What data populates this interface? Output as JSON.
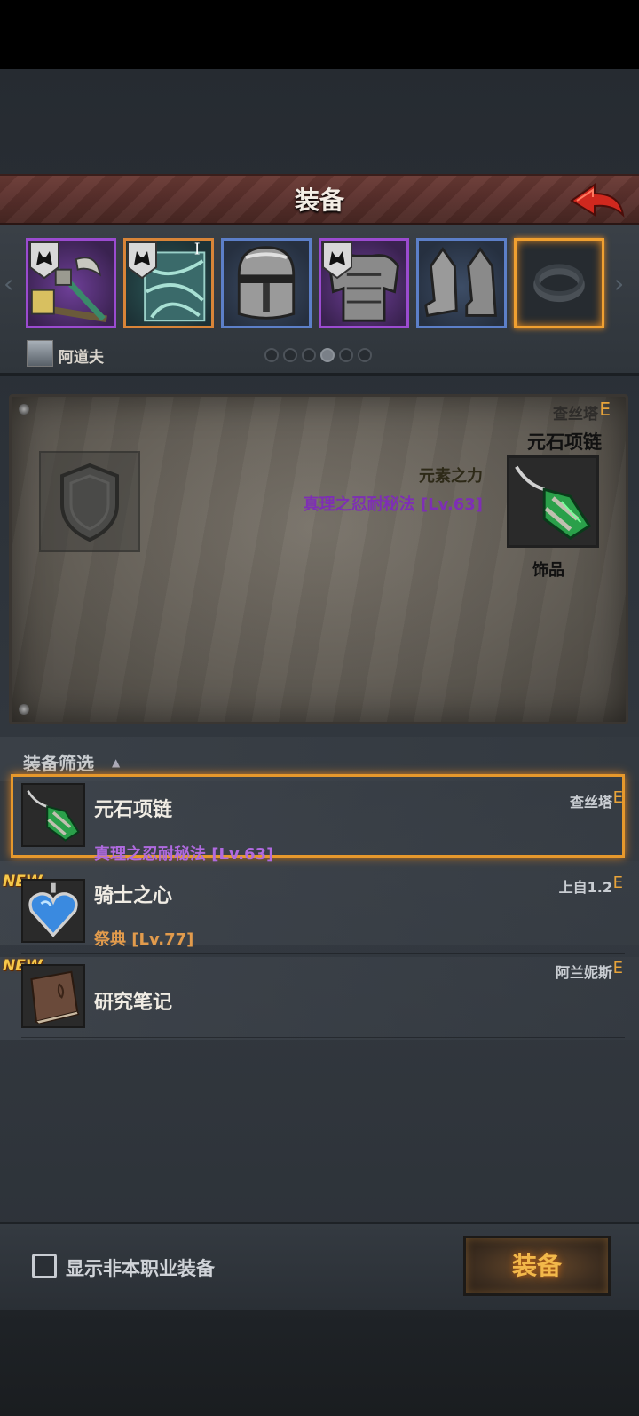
{
  "header": {
    "title": "装备"
  },
  "character": {
    "name": "阿道夫"
  },
  "slots": [
    {
      "name": "hammer",
      "rarity": "purple"
    },
    {
      "name": "tome",
      "rarity": "orange"
    },
    {
      "name": "helmet",
      "rarity": "blue"
    },
    {
      "name": "armor",
      "rarity": "purple"
    },
    {
      "name": "boots",
      "rarity": "blue"
    },
    {
      "name": "ring",
      "rarity": "empty"
    }
  ],
  "pager": {
    "count": 6,
    "active_index": 3
  },
  "detail": {
    "owner": "查丝塔",
    "grade": "E",
    "item_name": "元石项链",
    "skill_1": "元素之力",
    "skill_2": "真理之忍耐秘法 [Lv.63]",
    "item_type": "饰品"
  },
  "filter": {
    "label": "装备筛选"
  },
  "list": [
    {
      "name": "元石项链",
      "skill": "真理之忍耐秘法 [Lv.63]",
      "owner": "查丝塔",
      "grade": "E",
      "is_new": false,
      "selected": true
    },
    {
      "name": "骑士之心",
      "skill": "祭典 [Lv.77]",
      "owner": "上自1.2",
      "grade": "E",
      "is_new": true,
      "selected": false
    },
    {
      "name": "研究笔记",
      "skill": "",
      "owner": "阿兰妮斯",
      "grade": "E",
      "is_new": true,
      "selected": false
    }
  ],
  "new_badge": "NEW",
  "footer": {
    "checkbox_label": "显示非本职业装备",
    "equip_button": "装备"
  },
  "colors": {
    "accent_orange": "#e8a43a",
    "skill_purple": "#b06ae0",
    "selected_border": "#e6982c"
  }
}
